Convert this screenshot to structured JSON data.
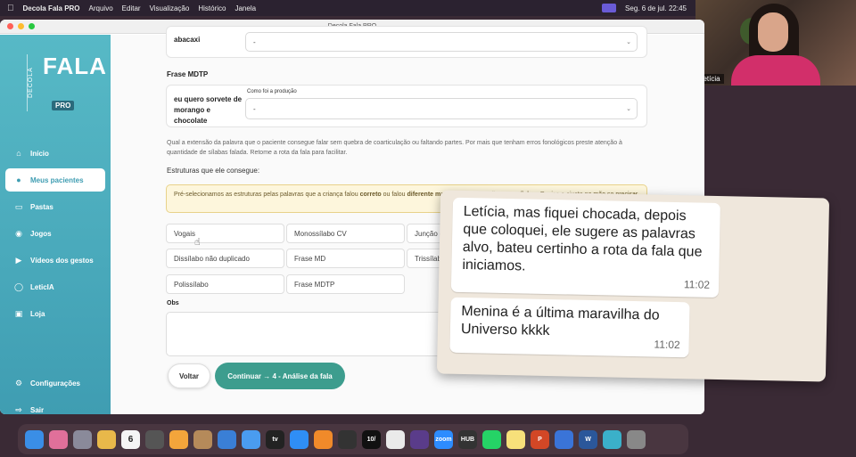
{
  "menubar": {
    "app_name": "Decola Fala PRO",
    "items": [
      "Arquivo",
      "Editar",
      "Visualização",
      "Histórico",
      "Janela"
    ],
    "clock": "Seg. 6 de jul. 22:45"
  },
  "video": {
    "participant_name": "Letícia"
  },
  "window": {
    "title": "Decola Fala PRO"
  },
  "logo": {
    "decola": "DECOLA",
    "fala": "FALA",
    "pro": "PRO"
  },
  "nav": {
    "items": [
      {
        "label": "Início",
        "icon": "home-icon"
      },
      {
        "label": "Meus pacientes",
        "icon": "user-icon"
      },
      {
        "label": "Pastas",
        "icon": "folder-icon"
      },
      {
        "label": "Jogos",
        "icon": "gamepad-icon"
      },
      {
        "label": "Vídeos dos gestos",
        "icon": "video-icon"
      },
      {
        "label": "LeticIA",
        "icon": "chat-icon"
      },
      {
        "label": "Loja",
        "icon": "bag-icon"
      }
    ],
    "bottom": [
      {
        "label": "Configurações",
        "icon": "gear-icon"
      },
      {
        "label": "Sair",
        "icon": "logout-icon"
      }
    ]
  },
  "form": {
    "top_word": "abacaxi",
    "top_select_value": "-",
    "phrase_section": "Frase MDTP",
    "phrase_text": "eu quero sorvete de morango e chocolate",
    "phrase_select_label": "Como foi a produção",
    "phrase_select_value": "-",
    "help_text": "Qual a extensão da palavra que o paciente consegue falar sem quebra de coarticulação ou faltando partes. Por mais que tenham erros fonológicos preste atenção à quantidade de sílabas falada. Retome a rota da fala para facilitar.",
    "structures_title": "Estruturas que ele consegue:",
    "notice_pre": "Pré-selecionamos as estruturas pelas palavras que a criança falou ",
    "notice_b1": "correto",
    "notice_mid": " ou falou ",
    "notice_b2": "diferente mantendo a extensão, sem sílabar",
    "notice_post": ". Revise e ajuste na mão se precisar.",
    "chips": [
      "Vogais",
      "Monossílabo CV",
      "Junção d",
      "Dissílabo não duplicado",
      "Frase MD",
      "Trissílab",
      "Polissílabo",
      "Frase MDTP"
    ],
    "obs_label": "Obs",
    "back_button": "Voltar",
    "continue_button": "Continuar → 4 - Análise da fala"
  },
  "whatsapp": {
    "messages": [
      {
        "text": "Letícia, mas fiquei chocada, depois que coloquei, ele sugere as palavras alvo, bateu certinho a rota da fala que iniciamos.",
        "time": "11:02"
      },
      {
        "text": "Menina  é a última maravilha do Universo kkkk",
        "time": "11:02"
      }
    ]
  },
  "dock": {
    "calendar_day": "6",
    "icons": [
      {
        "name": "finder-icon",
        "color": "#3a8ee6",
        "label": ""
      },
      {
        "name": "launchpad-icon",
        "color": "#e0709a",
        "label": ""
      },
      {
        "name": "apps-icon",
        "color": "#8a8a9a",
        "label": ""
      },
      {
        "name": "chrome-icon",
        "color": "#e8b84a",
        "label": ""
      },
      {
        "name": "calendar-icon",
        "color": "#f5f5f5",
        "label": ""
      },
      {
        "name": "screenshot-icon",
        "color": "#555",
        "label": ""
      },
      {
        "name": "pencil-icon",
        "color": "#f3a53b",
        "label": ""
      },
      {
        "name": "box-icon",
        "color": "#b58a5a",
        "label": ""
      },
      {
        "name": "keynote-icon",
        "color": "#3a7fd6",
        "label": ""
      },
      {
        "name": "mail-icon",
        "color": "#4a9cf0",
        "label": ""
      },
      {
        "name": "appletv-icon",
        "color": "#222",
        "label": "tv"
      },
      {
        "name": "appstore-icon",
        "color": "#2f8ef5",
        "label": ""
      },
      {
        "name": "books-icon",
        "color": "#f08a2a",
        "label": ""
      },
      {
        "name": "openai-icon",
        "color": "#333",
        "label": ""
      },
      {
        "name": "text-icon",
        "color": "#111",
        "label": "10/"
      },
      {
        "name": "capcut-icon",
        "color": "#eaeaea",
        "label": ""
      },
      {
        "name": "slack-icon",
        "color": "#5a3c8a",
        "label": ""
      },
      {
        "name": "zoom-icon",
        "color": "#2d8cff",
        "label": "zoom"
      },
      {
        "name": "hub-icon",
        "color": "#333",
        "label": "HUB"
      },
      {
        "name": "whatsapp-icon",
        "color": "#25d366",
        "label": ""
      },
      {
        "name": "notes-icon",
        "color": "#f7e07a",
        "label": ""
      },
      {
        "name": "powerpoint-icon",
        "color": "#d24726",
        "label": "P"
      },
      {
        "name": "accessibility-icon",
        "color": "#3a74d8",
        "label": ""
      },
      {
        "name": "word-icon",
        "color": "#2b579a",
        "label": "W"
      },
      {
        "name": "preview-icon",
        "color": "#3bb0c9",
        "label": ""
      },
      {
        "name": "trash-icon",
        "color": "#888",
        "label": ""
      }
    ]
  }
}
